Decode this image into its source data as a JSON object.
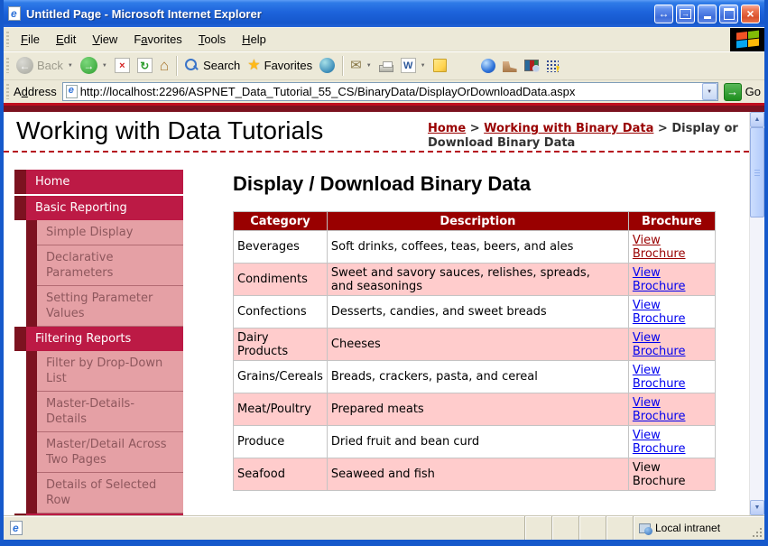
{
  "window": {
    "title": "Untitled Page - Microsoft Internet Explorer"
  },
  "menu_bar": {
    "items": [
      {
        "pre": "",
        "key": "F",
        "post": "ile"
      },
      {
        "pre": "",
        "key": "E",
        "post": "dit"
      },
      {
        "pre": "",
        "key": "V",
        "post": "iew"
      },
      {
        "pre": "F",
        "key": "a",
        "post": "vorites"
      },
      {
        "pre": "",
        "key": "T",
        "post": "ools"
      },
      {
        "pre": "",
        "key": "H",
        "post": "elp"
      }
    ]
  },
  "toolbar": {
    "back_label": "Back",
    "search_label": "Search",
    "favorites_label": "Favorites",
    "word_letter": "W"
  },
  "address_bar": {
    "label_pre": "A",
    "label_key": "d",
    "label_post": "dress",
    "url": "http://localhost:2296/ASPNET_Data_Tutorial_55_CS/BinaryData/DisplayOrDownloadData.aspx",
    "go_label": "Go"
  },
  "page": {
    "header": {
      "title": "Working with Data Tutorials",
      "breadcrumb": [
        {
          "sep": "",
          "label": "Home",
          "variant": "link"
        },
        {
          "sep": " > ",
          "label": "Working with Binary Data",
          "variant": "link"
        },
        {
          "sep": " > ",
          "label": "Display or Download Binary Data",
          "variant": "current"
        }
      ]
    },
    "sidebar": {
      "items": [
        {
          "label": "Home",
          "variant": "section"
        },
        {
          "label": "Basic Reporting",
          "variant": "section"
        },
        {
          "label": "Simple Display",
          "variant": "sub"
        },
        {
          "label": "Declarative\nParameters",
          "variant": "sub"
        },
        {
          "label": "Setting Parameter\nValues",
          "variant": "sub"
        },
        {
          "label": "Filtering Reports",
          "variant": "section"
        },
        {
          "label": "Filter by Drop-Down\nList",
          "variant": "sub"
        },
        {
          "label": "Master-Details-\nDetails",
          "variant": "sub"
        },
        {
          "label": "Master/Detail Across\nTwo Pages",
          "variant": "sub"
        },
        {
          "label": "Details of Selected\nRow",
          "variant": "sub"
        }
      ]
    },
    "main": {
      "title": "Display / Download Binary Data",
      "table": {
        "headers": [
          "Category",
          "Description",
          "Brochure"
        ],
        "rows": [
          {
            "category": "Beverages",
            "description": "Soft drinks, coffees, teas, beers, and ales",
            "brochure": "View Brochure",
            "variant": "white",
            "link_class": "visited"
          },
          {
            "category": "Condiments",
            "description": "Sweet and savory sauces, relishes, spreads,\nand seasonings",
            "brochure": "View Brochure",
            "variant": "pink",
            "link_class": "link"
          },
          {
            "category": "Confections",
            "description": "Desserts, candies, and sweet breads",
            "brochure": "View Brochure",
            "variant": "white",
            "link_class": "link"
          },
          {
            "category": "Dairy\nProducts",
            "description": "Cheeses",
            "brochure": "View Brochure",
            "variant": "pink",
            "link_class": "link"
          },
          {
            "category": "Grains/Cereals",
            "description": "Breads, crackers, pasta, and cereal",
            "brochure": "View Brochure",
            "variant": "white",
            "link_class": "link"
          },
          {
            "category": "Meat/Poultry",
            "description": "Prepared meats",
            "brochure": "View Brochure",
            "variant": "pink",
            "link_class": "link"
          },
          {
            "category": "Produce",
            "description": "Dried fruit and bean curd",
            "brochure": "View Brochure",
            "variant": "white",
            "link_class": "link"
          },
          {
            "category": "Seafood",
            "description": "Seaweed and fish",
            "brochure": "View Brochure",
            "variant": "pink",
            "link_class": "none"
          }
        ]
      }
    }
  },
  "status_bar": {
    "zone_label": "Local intranet"
  },
  "colors": {
    "accent_crimson": "#BC1A45",
    "maroon_band": "#7C1220",
    "table_header": "#990000",
    "row_pink": "#FFCCCC",
    "link_blue": "#0000EE",
    "link_maroon": "#990000",
    "chrome_bg": "#ECE9D8"
  }
}
